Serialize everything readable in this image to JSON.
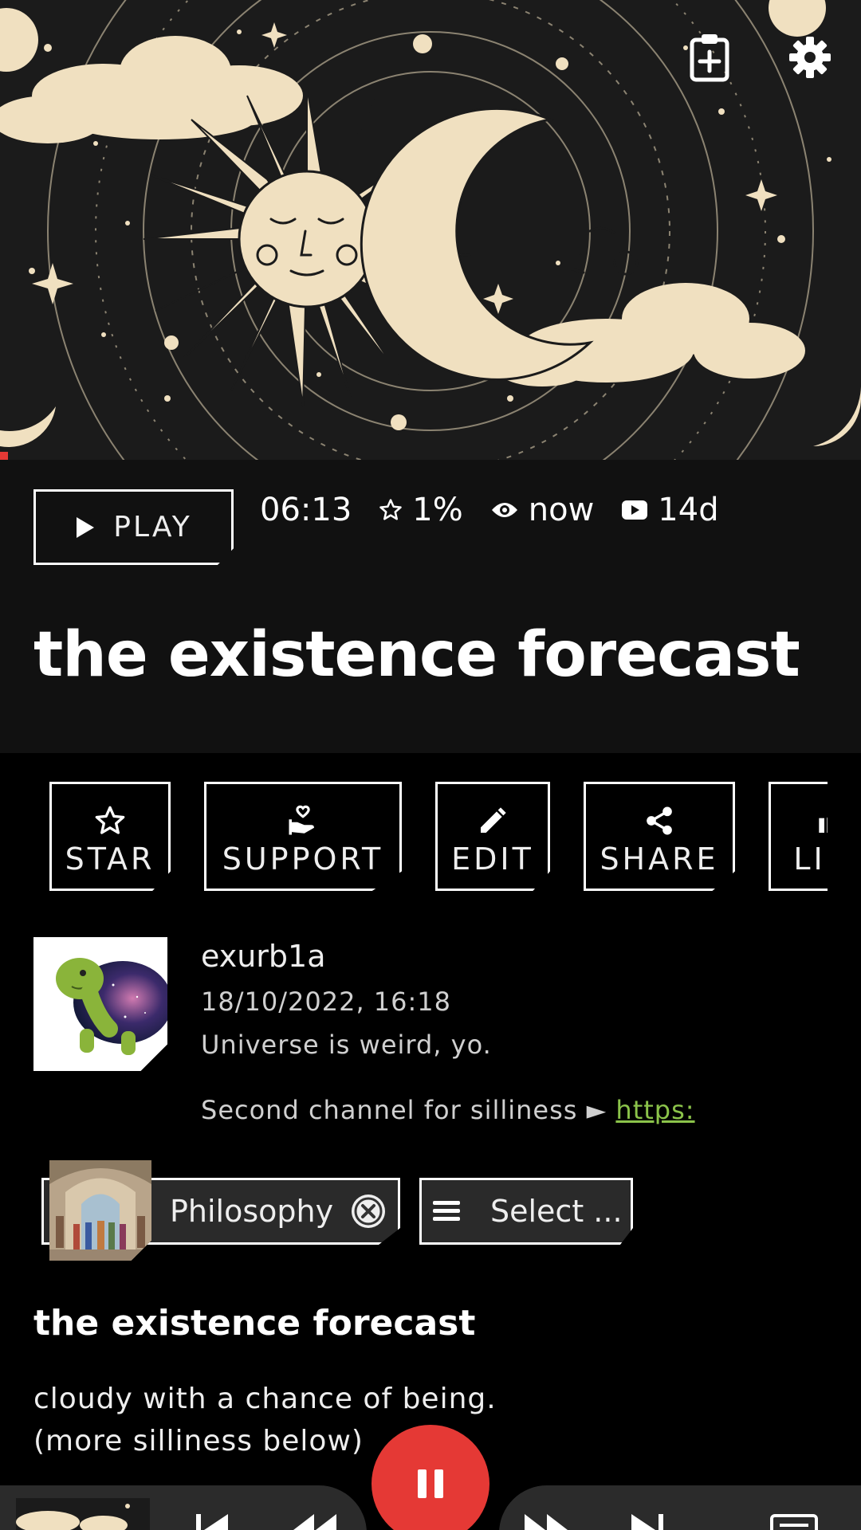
{
  "hero": {
    "top_icons": [
      "clipboard-add-icon",
      "gear-icon"
    ]
  },
  "info": {
    "play_label": "PLAY",
    "duration": "06:13",
    "rating": "1%",
    "watched": "now",
    "age": "14d",
    "title": "the existence forecast"
  },
  "actions": [
    {
      "label": "STAR",
      "icon": "star-outline-icon"
    },
    {
      "label": "SUPPORT",
      "icon": "hand-heart-icon"
    },
    {
      "label": "EDIT",
      "icon": "pencil-icon"
    },
    {
      "label": "SHARE",
      "icon": "share-icon"
    },
    {
      "label": "LIKE",
      "icon": "thumb-up-icon"
    }
  ],
  "channel": {
    "name": "exurb1a",
    "date": "18/10/2022, 16:18",
    "description": "Universe is weird, yo.",
    "description2": "Second channel for silliness ► ",
    "link": "https:"
  },
  "tags": {
    "chip_label": "Philosophy",
    "select_label": "Select ..."
  },
  "description": {
    "title": "the existence forecast",
    "line1": "cloudy with a chance of being.",
    "line2": "(more silliness below)"
  },
  "colors": {
    "accent": "#e53935",
    "panel": "#111111",
    "link": "#8bc34a",
    "art_bg": "#1b1b1b",
    "art_fg": "#f0e0c0"
  }
}
